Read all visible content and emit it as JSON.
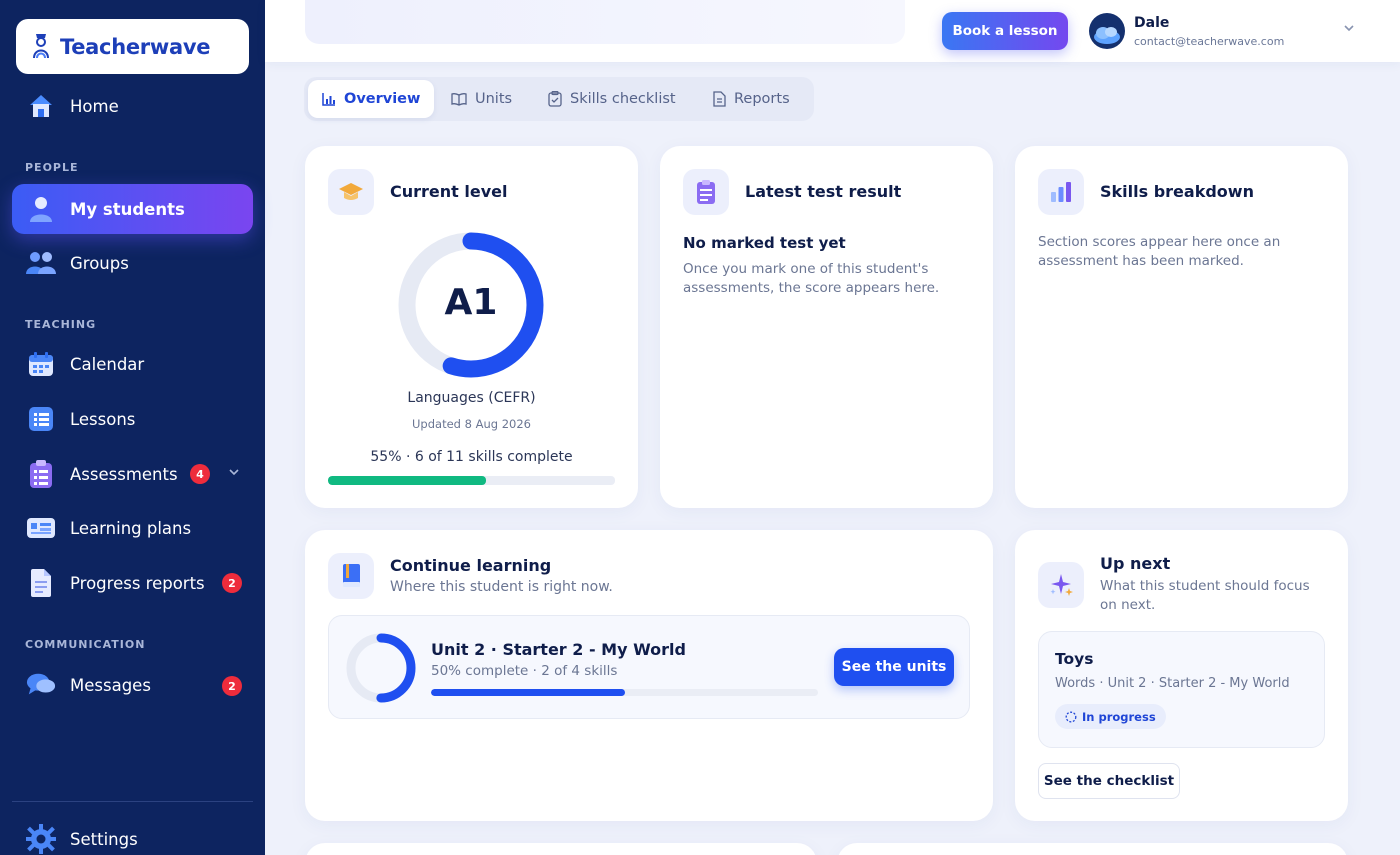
{
  "app": {
    "name": "Teacherwave"
  },
  "sidebar": {
    "home": "Home",
    "sections": {
      "people": "PEOPLE",
      "teaching": "TEACHING",
      "communication": "COMMUNICATION"
    },
    "items": {
      "my_students": "My students",
      "groups": "Groups",
      "calendar": "Calendar",
      "lessons": "Lessons",
      "assessments": "Assessments",
      "assessments_badge": "4",
      "learning_plans": "Learning plans",
      "progress_reports": "Progress reports",
      "progress_reports_badge": "2",
      "messages": "Messages",
      "messages_badge": "2",
      "settings": "Settings"
    }
  },
  "header": {
    "book_button": "Book a lesson",
    "user_name": "Dale",
    "user_email": "contact@teacherwave.com"
  },
  "tabs": [
    "Overview",
    "Units",
    "Skills checklist",
    "Reports"
  ],
  "current_level": {
    "title": "Current level",
    "level": "A1",
    "framework": "Languages (CEFR)",
    "updated": "Updated 8 Aug 2026",
    "progress_text": "55% · 6 of 11 skills complete",
    "progress_fraction": 0.55,
    "ring_fraction": 0.55,
    "colors": {
      "ring": "#1f4ff0",
      "bar": "#10b981"
    }
  },
  "latest_test": {
    "title": "Latest test result",
    "heading": "No marked test yet",
    "body": "Once you mark one of this student's assessments, the score appears here."
  },
  "skills_breakdown": {
    "title": "Skills breakdown",
    "body": "Section scores appear here once an assessment has been marked."
  },
  "continue_learning": {
    "title": "Continue learning",
    "subtitle": "Where this student is right now.",
    "unit": "Unit 2 · Starter 2 - My World",
    "progress_text": "50% complete · 2 of 4 skills",
    "progress_fraction": 0.5,
    "button": "See the units"
  },
  "up_next": {
    "title": "Up next",
    "subtitle": "What this student should focus on next.",
    "item_title": "Toys",
    "item_meta": "Words · Unit 2 · Starter 2 - My World",
    "status": "In progress",
    "button": "See the checklist"
  }
}
